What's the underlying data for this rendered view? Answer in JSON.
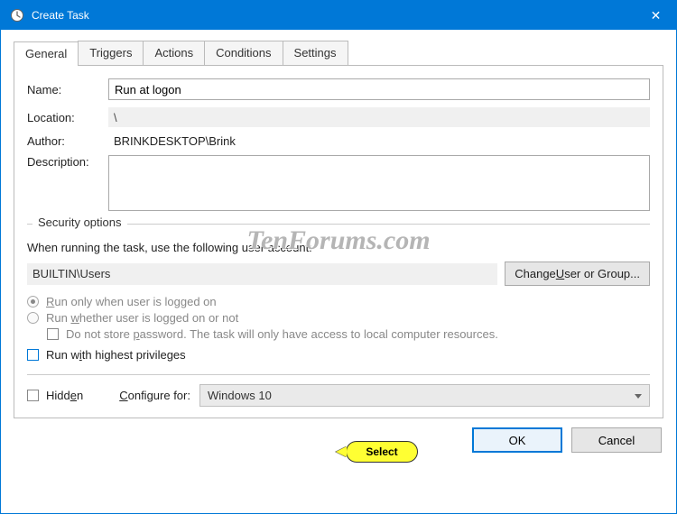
{
  "window": {
    "title": "Create Task",
    "close_glyph": "✕"
  },
  "tabs": {
    "general": "General",
    "triggers": "Triggers",
    "actions": "Actions",
    "conditions": "Conditions",
    "settings": "Settings"
  },
  "labels": {
    "name": "Name:",
    "location": "Location:",
    "author": "Author:",
    "description": "Description:"
  },
  "fields": {
    "name": "Run at logon",
    "location": "\\",
    "author": "BRINKDESKTOP\\Brink",
    "description": ""
  },
  "security": {
    "legend": "Security options",
    "when_running": "When running the task, use the following user account:",
    "account": "BUILTIN\\Users",
    "change_btn_pre": "Change ",
    "change_btn_u": "U",
    "change_btn_post": "ser or Group...",
    "run_logged_on_pre": "",
    "run_logged_on_u": "R",
    "run_logged_on_post": "un only when user is logged on",
    "run_whether_pre": "Run ",
    "run_whether_u": "w",
    "run_whether_post": "hether user is logged on or not",
    "dont_store_pre": "Do not store ",
    "dont_store_u": "p",
    "dont_store_post": "assword.  The task will only have access to local computer resources.",
    "highest_pre": "Run w",
    "highest_u": "i",
    "highest_post": "th highest privileges"
  },
  "bottom": {
    "hidden_pre": "Hidd",
    "hidden_u": "e",
    "hidden_post": "n",
    "configure_pre": "",
    "configure_u": "C",
    "configure_post": "onfigure for:",
    "configure_value": "Windows 10"
  },
  "footer": {
    "ok": "OK",
    "cancel": "Cancel"
  },
  "overlay": {
    "watermark": "TenForums.com",
    "callout": "Select"
  }
}
